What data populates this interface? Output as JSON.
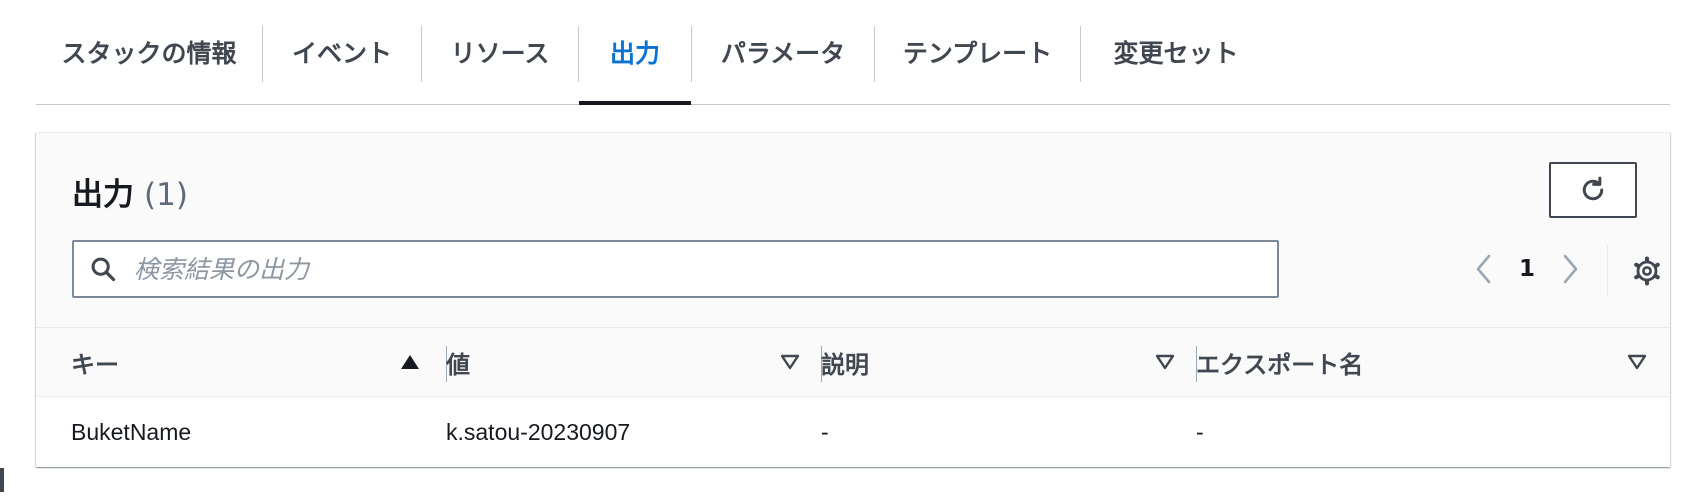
{
  "tabs": [
    {
      "label": "スタックの情報",
      "active": false
    },
    {
      "label": "イベント",
      "active": false
    },
    {
      "label": "リソース",
      "active": false
    },
    {
      "label": "出力",
      "active": true
    },
    {
      "label": "パラメータ",
      "active": false
    },
    {
      "label": "テンプレート",
      "active": false
    },
    {
      "label": "変更セット",
      "active": false
    }
  ],
  "panel": {
    "title": "出力",
    "count": "(1)",
    "refresh_icon": "refresh-icon",
    "search": {
      "placeholder": "検索結果の出力",
      "value": "",
      "icon": "search-icon"
    },
    "pagination": {
      "current_page": "1",
      "prev_icon": "chevron-left-icon",
      "next_icon": "chevron-right-icon"
    },
    "settings_icon": "gear-icon"
  },
  "table": {
    "columns": [
      {
        "label": "キー",
        "sort": "ascending"
      },
      {
        "label": "値",
        "sort": "none"
      },
      {
        "label": "説明",
        "sort": "none"
      },
      {
        "label": "エクスポート名",
        "sort": "none"
      }
    ],
    "rows": [
      {
        "key": "BuketName",
        "value": "k.satou-20230907",
        "description": "-",
        "export_name": "-"
      }
    ]
  },
  "colors": {
    "accent": "#0972d3",
    "text": "#16191f",
    "muted": "#5f6b7a",
    "border": "#7d8998"
  }
}
